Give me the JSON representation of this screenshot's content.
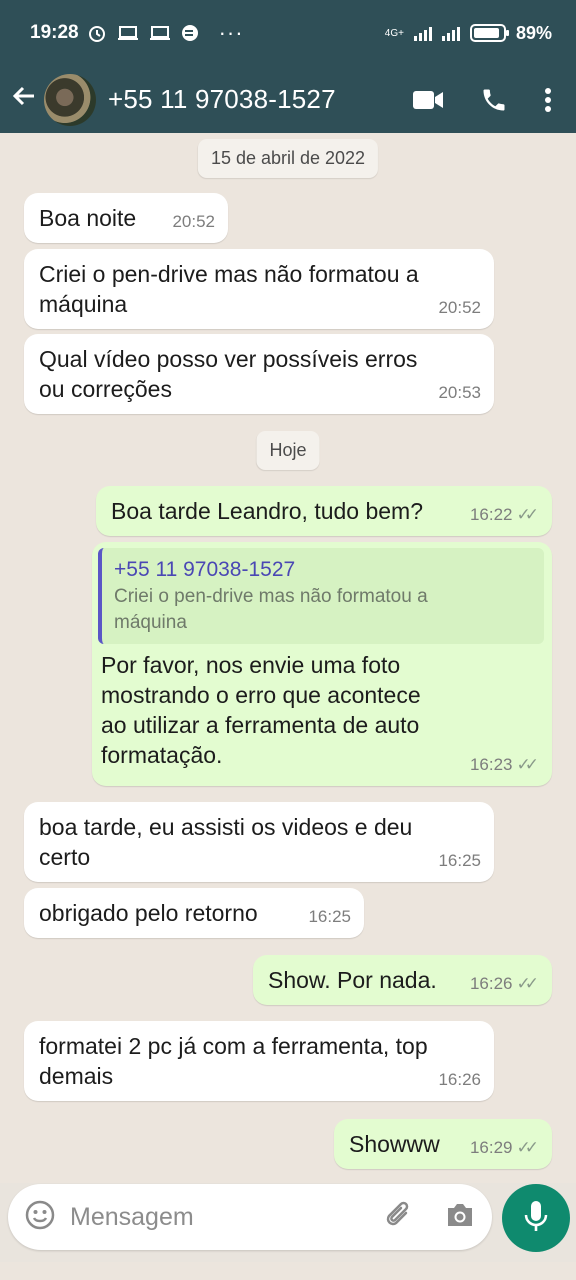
{
  "status": {
    "time": "19:28",
    "network": "4G+",
    "battery": "89%",
    "battery_level": 0.89
  },
  "header": {
    "contact": "+55 11 97038-1527"
  },
  "chat": {
    "dates": [
      "15 de abril de 2022",
      "Hoje"
    ],
    "messages": [
      {
        "dir": "in",
        "text": "Boa noite",
        "time": "20:52"
      },
      {
        "dir": "in",
        "text": "Criei o pen-drive mas não formatou a\nmáquina",
        "time": "20:52"
      },
      {
        "dir": "in",
        "text": "Qual vídeo posso ver possíveis erros\nou correções",
        "time": "20:53"
      },
      {
        "dir": "out",
        "text": "Boa tarde Leandro, tudo bem?",
        "time": "16:22"
      },
      {
        "dir": "out",
        "quote_name": "+55 11 97038-1527",
        "quote_text": "Criei o pen-drive mas não formatou a\nmáquina",
        "text": "Por favor, nos envie uma foto\nmostrando o erro que acontece\nao utilizar a ferramenta de auto\nformatação.",
        "time": "16:23"
      },
      {
        "dir": "in",
        "text": "boa tarde, eu assisti os videos e deu\ncerto",
        "time": "16:25"
      },
      {
        "dir": "in",
        "text": "obrigado pelo retorno",
        "time": "16:25"
      },
      {
        "dir": "out",
        "text": "Show. Por nada.",
        "time": "16:26"
      },
      {
        "dir": "in",
        "text": "formatei 2 pc já com a ferramenta, top\ndemais",
        "time": "16:26"
      },
      {
        "dir": "out",
        "text": "Showww",
        "time": "16:29"
      }
    ]
  },
  "input": {
    "placeholder": "Mensagem"
  },
  "icons": [
    "back-arrow-icon",
    "video-call-icon",
    "phone-icon",
    "more-vert-icon",
    "emoji-icon",
    "attach-icon",
    "camera-icon",
    "mic-icon"
  ],
  "colors": {
    "header": "#2f4f57",
    "outgoing": "#e3fcd0",
    "incoming": "#ffffff",
    "mic": "#0f8a6e",
    "quote_name": "#4a47b4"
  }
}
